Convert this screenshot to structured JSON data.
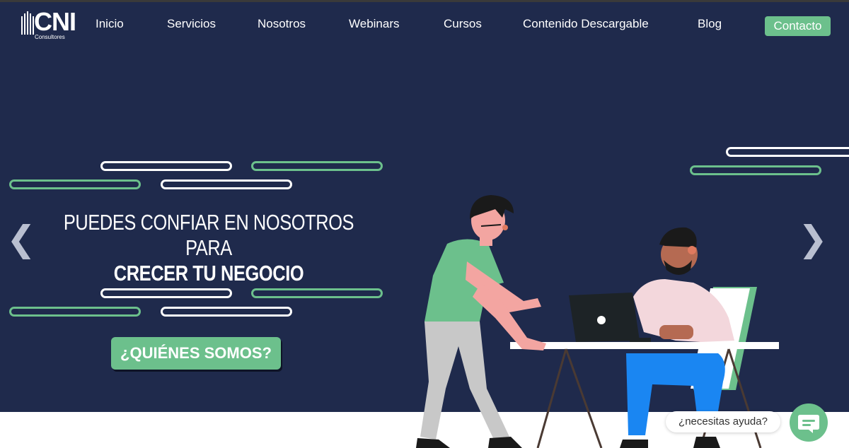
{
  "brand": {
    "logo_text": "CNI",
    "logo_sub": "Consultores"
  },
  "nav": {
    "items": [
      "Inicio",
      "Servicios",
      "Nosotros",
      "Webinars",
      "Cursos",
      "Contenido Descargable",
      "Blog"
    ],
    "cta": "Contacto"
  },
  "hero": {
    "line1": "PUEDES CONFIAR EN NOSOTROS PARA",
    "line2": "CRECER TU NEGOCIO",
    "button": "¿QUIÉNES SOMOS?",
    "prev_icon": "❮",
    "next_icon": "❯"
  },
  "help": {
    "text": "¿necesitas ayuda?",
    "chat_icon": "chat-bubble-icon"
  },
  "colors": {
    "navy": "#1f2a4c",
    "green": "#6cc08c",
    "white": "#ffffff"
  }
}
